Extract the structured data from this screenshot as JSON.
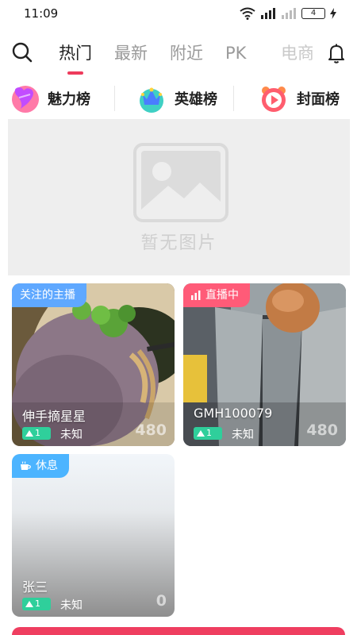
{
  "status": {
    "time": "11:09",
    "battery": "4"
  },
  "nav": {
    "tabs": [
      {
        "label": "热门"
      },
      {
        "label": "最新"
      },
      {
        "label": "附近"
      },
      {
        "label": "PK"
      },
      {
        "label": "电商"
      }
    ],
    "active_tab": "热门"
  },
  "ranks": [
    {
      "label": "魅力榜",
      "icon": "heart-rank-icon"
    },
    {
      "label": "英雄榜",
      "icon": "crown-rank-icon"
    },
    {
      "label": "封面榜",
      "icon": "play-rank-icon"
    }
  ],
  "banner": {
    "placeholder_text": "暂无图片"
  },
  "streams": [
    {
      "tag": "关注的主播",
      "name": "伸手摘星星",
      "level": "1",
      "city": "未知",
      "viewers": "480"
    },
    {
      "tag": "直播中",
      "name": "GMH100079",
      "level": "1",
      "city": "未知",
      "viewers": "480"
    },
    {
      "tag": "休息",
      "name": "张三",
      "level": "1",
      "city": "未知",
      "viewers": "0"
    }
  ],
  "colors": {
    "accent": "#ee3b5c",
    "level_badge": "#2fcf9b",
    "live_tag": "#ff5b78",
    "follow_tag": "#5fa8ff"
  }
}
